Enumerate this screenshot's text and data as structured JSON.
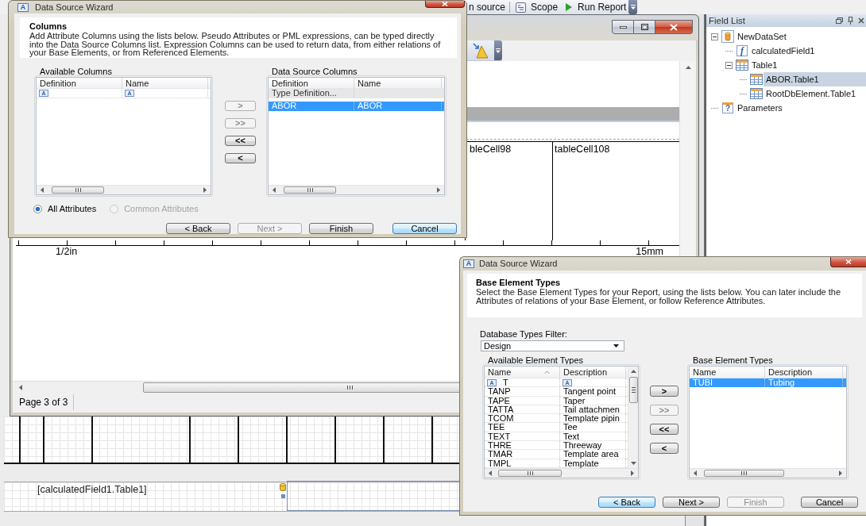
{
  "app_toolbar": {
    "items": [
      {
        "kind": "text",
        "label": "n source"
      },
      {
        "kind": "scope",
        "label": "Scope"
      },
      {
        "kind": "run",
        "label": "Run Report"
      }
    ]
  },
  "preview_window": {
    "table_cells": [
      "bleCell98",
      "tableCell108"
    ],
    "ruler_labels": [
      "1/2in",
      "15mm"
    ],
    "status": "Page 3 of 3"
  },
  "designer": {
    "field_text": "[calculatedField1.Table1]"
  },
  "field_list": {
    "title": "Field List",
    "tree": [
      {
        "label": "NewDataSet",
        "kind": "dataset",
        "expanded": true,
        "selected": false,
        "children": [
          {
            "label": "calculatedField1",
            "kind": "field",
            "glyph": "f",
            "selected": false
          },
          {
            "label": "Table1",
            "kind": "table",
            "expanded": true,
            "selected": false,
            "children": [
              {
                "label": "ABOR.Table1",
                "kind": "table",
                "selected": true
              },
              {
                "label": "RootDbElement.Table1",
                "kind": "table",
                "selected": false
              }
            ]
          }
        ]
      },
      {
        "label": "Parameters",
        "kind": "parameters",
        "glyph": "?",
        "selected": false
      }
    ]
  },
  "columns_wizard": {
    "title": "Data Source Wizard",
    "icon_glyph": "A",
    "heading": "Columns",
    "description": "Add Attribute Columns using the lists below. Pseudo Attributes or PML expressions, can be typed directly into the Data Source Columns list. Expression Columns can be used to return data, from either relations of your Base Elements, or from Referenced Elements.",
    "available": {
      "label": "Available Columns",
      "columns": [
        {
          "label": "Definition",
          "sorted": false
        },
        {
          "label": "Name",
          "sorted": false
        }
      ],
      "rows": [
        {
          "kind": "filter",
          "selected": false,
          "cells": [
            {
              "glyph": "A"
            },
            {
              "glyph": "A"
            }
          ]
        }
      ]
    },
    "transfer_buttons": [
      {
        "label": ">",
        "disabled": true
      },
      {
        "label": ">>",
        "disabled": true
      },
      {
        "label": "<<",
        "disabled": false
      },
      {
        "label": "<",
        "disabled": false
      }
    ],
    "chosen": {
      "label": "Data Source Columns",
      "columns": [
        {
          "label": "Definition",
          "sorted": false
        },
        {
          "label": "Name",
          "sorted": false
        }
      ],
      "rows": [
        {
          "kind": "template",
          "selected": false,
          "cells": [
            {
              "text": "Type Definition..."
            }
          ]
        },
        {
          "kind": "item",
          "selected": true,
          "cells": [
            {
              "text": "ABOR"
            },
            {
              "text": "ABOR"
            }
          ]
        }
      ]
    },
    "scope_options": [
      {
        "label": "All Attributes",
        "selected": true,
        "disabled": false
      },
      {
        "label": "Common Attributes",
        "selected": false,
        "disabled": true
      }
    ],
    "buttons": [
      {
        "label": "< Back",
        "disabled": false,
        "focused": false
      },
      {
        "label": "Next >",
        "disabled": true,
        "focused": false
      },
      {
        "label": "Finish",
        "disabled": false,
        "focused": false
      },
      {
        "label": "Cancel",
        "disabled": false,
        "focused": true
      }
    ]
  },
  "base_types_wizard": {
    "title": "Data Source Wizard",
    "icon_glyph": "A",
    "heading": "Base Element Types",
    "description": "Select the Base Element Types for your Report, using the lists below. You can later include the Attributes of relations of your Base Element, or follow Reference Attributes.",
    "filter": {
      "label": "Database Types Filter:",
      "value": "Design"
    },
    "available": {
      "label": "Available Element Types",
      "columns": [
        {
          "label": "Name",
          "sorted": true
        },
        {
          "label": "Description",
          "sorted": false
        }
      ],
      "rows": [
        {
          "kind": "filter",
          "selected": false,
          "cells": [
            {
              "glyph": "A",
              "text": "T"
            },
            {
              "glyph": "A"
            }
          ]
        },
        {
          "kind": "item",
          "selected": false,
          "cells": [
            {
              "text": "TANP"
            },
            {
              "text": "Tangent point"
            }
          ]
        },
        {
          "kind": "item",
          "selected": false,
          "cells": [
            {
              "text": "TAPE"
            },
            {
              "text": "Taper"
            }
          ]
        },
        {
          "kind": "item",
          "selected": false,
          "cells": [
            {
              "text": "TATTA"
            },
            {
              "text": "Tail attachmen"
            }
          ]
        },
        {
          "kind": "item",
          "selected": false,
          "cells": [
            {
              "text": "TCOM"
            },
            {
              "text": "Template pipin"
            }
          ]
        },
        {
          "kind": "item",
          "selected": false,
          "cells": [
            {
              "text": "TEE"
            },
            {
              "text": "Tee"
            }
          ]
        },
        {
          "kind": "item",
          "selected": false,
          "cells": [
            {
              "text": "TEXT"
            },
            {
              "text": "Text"
            }
          ]
        },
        {
          "kind": "item",
          "selected": false,
          "cells": [
            {
              "text": "THRE"
            },
            {
              "text": "Threeway"
            }
          ]
        },
        {
          "kind": "item",
          "selected": false,
          "cells": [
            {
              "text": "TMAR"
            },
            {
              "text": "Template area"
            }
          ]
        },
        {
          "kind": "item",
          "selected": false,
          "cells": [
            {
              "text": "TMPL"
            },
            {
              "text": "Template"
            }
          ]
        }
      ]
    },
    "transfer_buttons": [
      {
        "label": ">",
        "disabled": false
      },
      {
        "label": ">>",
        "disabled": true
      },
      {
        "label": "<<",
        "disabled": false
      },
      {
        "label": "<",
        "disabled": false
      }
    ],
    "chosen": {
      "label": "Base Element Types",
      "columns": [
        {
          "label": "Name",
          "sorted": false
        },
        {
          "label": "Description",
          "sorted": false
        }
      ],
      "rows": [
        {
          "kind": "item",
          "selected": true,
          "cells": [
            {
              "text": "TUBI"
            },
            {
              "text": "Tubing"
            }
          ]
        }
      ]
    },
    "buttons": [
      {
        "label": "< Back",
        "disabled": false,
        "focused": true
      },
      {
        "label": "Next >",
        "disabled": false,
        "focused": false
      },
      {
        "label": "Finish",
        "disabled": true,
        "focused": false
      },
      {
        "label": "Cancel",
        "disabled": false,
        "focused": false
      }
    ]
  }
}
